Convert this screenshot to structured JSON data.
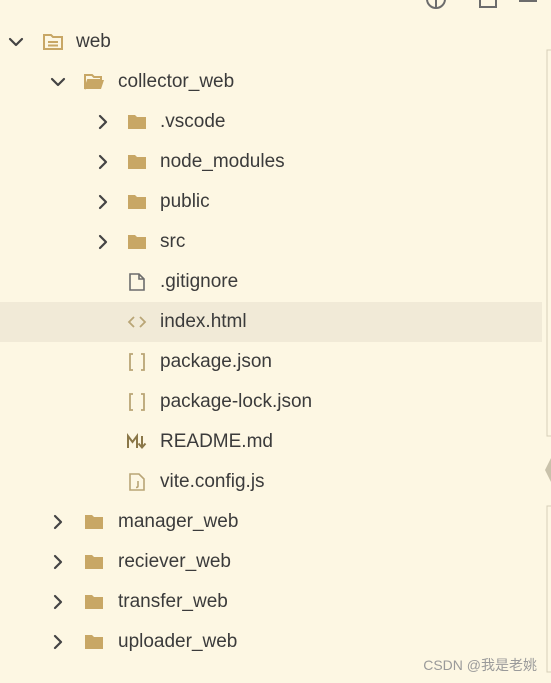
{
  "explorer": {
    "items": [
      {
        "label": "web",
        "kind": "folder-open",
        "expanded": true
      },
      {
        "label": "collector_web",
        "kind": "folder-open",
        "expanded": true
      },
      {
        "label": ".vscode",
        "kind": "folder",
        "expanded": false
      },
      {
        "label": "node_modules",
        "kind": "folder",
        "expanded": false
      },
      {
        "label": "public",
        "kind": "folder",
        "expanded": false
      },
      {
        "label": "src",
        "kind": "folder",
        "expanded": false
      },
      {
        "label": ".gitignore",
        "kind": "file"
      },
      {
        "label": "index.html",
        "kind": "html",
        "selected": true
      },
      {
        "label": "package.json",
        "kind": "json"
      },
      {
        "label": "package-lock.json",
        "kind": "json"
      },
      {
        "label": "README.md",
        "kind": "markdown"
      },
      {
        "label": "vite.config.js",
        "kind": "js"
      },
      {
        "label": "manager_web",
        "kind": "folder",
        "expanded": false
      },
      {
        "label": "reciever_web",
        "kind": "folder",
        "expanded": false
      },
      {
        "label": "transfer_web",
        "kind": "folder",
        "expanded": false
      },
      {
        "label": "uploader_web",
        "kind": "folder",
        "expanded": false
      }
    ]
  },
  "toolbar": {
    "icons": [
      "target-icon",
      "collapse-icon",
      "menu-icon"
    ]
  },
  "watermark": "CSDN @我是老姚",
  "colors": {
    "background": "#fdf7e3",
    "selected": "#f1ead7",
    "folder": "#c8a765",
    "icon": "#6c6c6c"
  }
}
